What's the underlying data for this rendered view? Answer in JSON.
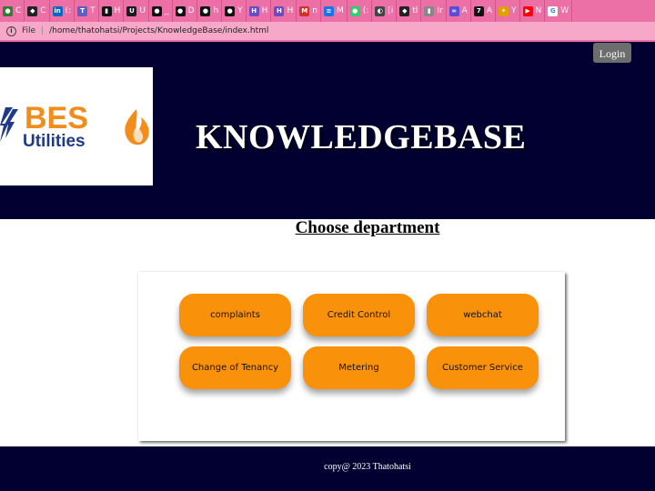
{
  "browser": {
    "tabs": [
      {
        "label": "C",
        "icon": "chrome-fav-icon",
        "color": "#2e7d32"
      },
      {
        "label": "C",
        "icon": "compass-fav-icon",
        "color": "#222222"
      },
      {
        "label": "(:",
        "icon": "linkedin-fav-icon",
        "color": "#0a66c2"
      },
      {
        "label": "T",
        "icon": "teams-fav-icon",
        "color": "#5b5fc7"
      },
      {
        "label": "H",
        "icon": "hub-fav-icon",
        "color": "#111111"
      },
      {
        "label": "U",
        "icon": "udemy-fav-icon",
        "color": "#1c1d1f"
      },
      {
        "label": "_",
        "icon": "github-fav-icon",
        "color": "#111111"
      },
      {
        "label": "D",
        "icon": "github-fav-icon",
        "color": "#111111"
      },
      {
        "label": "h",
        "icon": "github-fav-icon",
        "color": "#111111"
      },
      {
        "label": "Y",
        "icon": "github-fav-icon",
        "color": "#111111"
      },
      {
        "label": "H",
        "icon": "hyperskill-fav-icon",
        "color": "#6b4bc4"
      },
      {
        "label": "H",
        "icon": "hyperskill-fav-icon",
        "color": "#6b4bc4"
      },
      {
        "label": "n",
        "icon": "mail-fav-icon",
        "color": "#d93025"
      },
      {
        "label": "M",
        "icon": "docs-fav-icon",
        "color": "#1a73e8"
      },
      {
        "label": "(:",
        "icon": "whatsapp-fav-icon",
        "color": "#25d366"
      },
      {
        "label": "[i",
        "icon": "chat-fav-icon",
        "color": "#444444"
      },
      {
        "label": "tl",
        "icon": "compass-fav-icon",
        "color": "#222222"
      },
      {
        "label": "Ir",
        "icon": "bars-fav-icon",
        "color": "#888888"
      },
      {
        "label": "A",
        "icon": "ai-fav-icon",
        "color": "#5b4bd6"
      },
      {
        "label": "A",
        "icon": "seven-fav-icon",
        "color": "#111111"
      },
      {
        "label": "Y",
        "icon": "puzzle-fav-icon",
        "color": "#e0a000"
      },
      {
        "label": "N",
        "icon": "youtube-fav-icon",
        "color": "#ff0000"
      },
      {
        "label": "W",
        "icon": "google-fav-icon",
        "color": "#4285f4"
      }
    ],
    "address": {
      "scheme": "File",
      "url": "/home/thatohatsi/Projects/KnowledgeBase/index.html"
    }
  },
  "header": {
    "login_label": "Login",
    "logo": {
      "line1": "BES",
      "line2": "Utilities"
    },
    "title": "KNOWLEDGEBASE"
  },
  "main": {
    "heading": "Choose department",
    "departments": [
      {
        "label": "complaints"
      },
      {
        "label": "Credit Control"
      },
      {
        "label": "webchat"
      },
      {
        "label": "Change of Tenancy"
      },
      {
        "label": "Metering"
      },
      {
        "label": "Customer Service"
      }
    ]
  },
  "footer": {
    "text": "copy@ 2023 Thatohatsi"
  },
  "colors": {
    "navy": "#010030",
    "accent_orange": "#f9920a",
    "login_gray": "#6d6d6d",
    "tab_pink": "#ec6fa6",
    "logo_blue": "#1f3a8a",
    "logo_orange": "#f28c1a"
  }
}
